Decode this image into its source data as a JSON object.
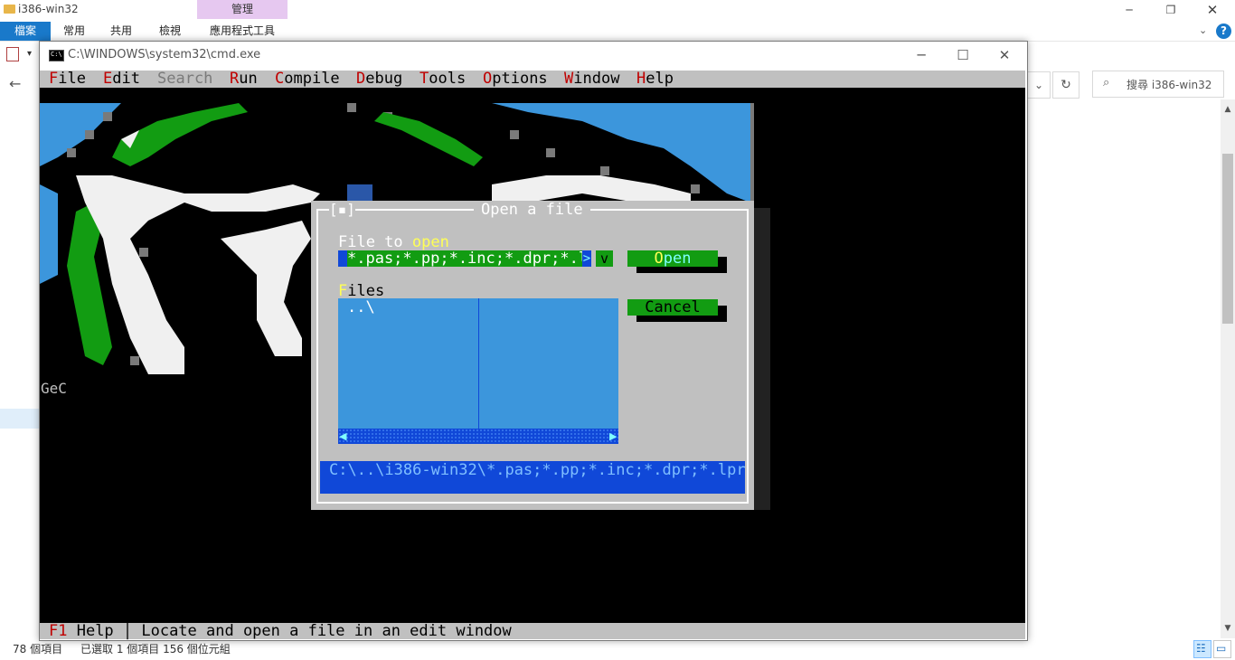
{
  "explorer": {
    "title": "i386-win32",
    "context_group": "管理",
    "tabs": [
      "檔案",
      "常用",
      "共用",
      "檢視",
      "應用程式工具"
    ],
    "search_placeholder": "搜尋 i386-win32",
    "status": {
      "items": "78 個項目",
      "selected": "已選取 1 個項目  156 個位元組"
    }
  },
  "cmd": {
    "title": "C:\\WINDOWS\\system32\\cmd.exe"
  },
  "ide": {
    "menu": [
      {
        "hot": "F",
        "rest": "ile"
      },
      {
        "hot": "E",
        "rest": "dit"
      },
      {
        "hot": "",
        "rest": "Search"
      },
      {
        "hot": "R",
        "rest": "un"
      },
      {
        "hot": "C",
        "rest": "ompile"
      },
      {
        "hot": "D",
        "rest": "ebug"
      },
      {
        "hot": "T",
        "rest": "ools"
      },
      {
        "hot": "O",
        "rest": "ptions"
      },
      {
        "hot": "W",
        "rest": "indow"
      },
      {
        "hot": "H",
        "rest": "elp"
      }
    ],
    "background_text": "GeC",
    "status_key": "F1",
    "status_text": " Help │ Locate and open a file in an edit window"
  },
  "dialog": {
    "close_glyph": "[▪]",
    "title": "Open a file",
    "file_label_hot": "File to ",
    "file_label_rest": "open",
    "file_value": "*.pas;*.pp;*.inc;*.dpr;*.l",
    "history_glyph": "v",
    "files_label_hot": "F",
    "files_label_rest": "iles",
    "list_items": [
      "..\\"
    ],
    "open_hot": "O",
    "open_rest": "pen",
    "cancel_label": "Cancel",
    "path": "C:\\..\\i386-win32\\*.pas;*.pp;*.inc;*.dpr;*.lpr"
  },
  "colors": {
    "dialog_gray": "#c0c0c0",
    "tv_green": "#129c12",
    "tv_blue": "#1048d8",
    "list_blue": "#3c96dc",
    "hotkey_red": "#c00000",
    "sky": "#3c96dc"
  }
}
